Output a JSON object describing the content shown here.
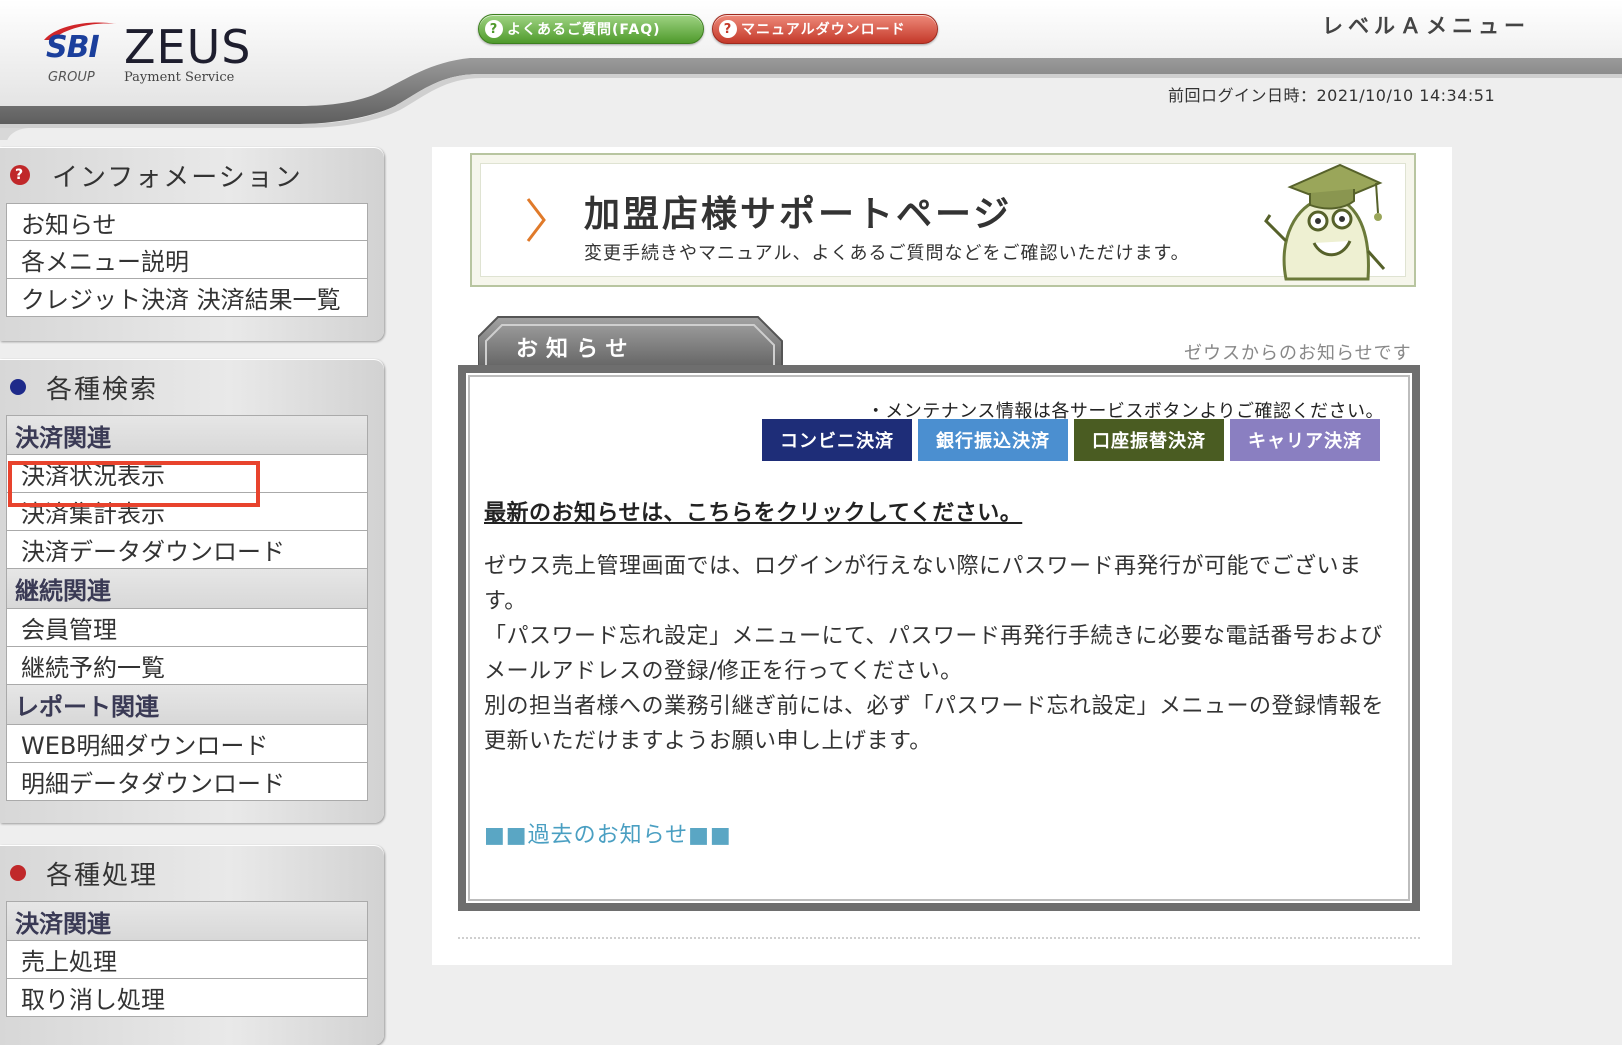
{
  "header": {
    "logo_sbi": "SBI",
    "logo_zeus": "ZEUS",
    "logo_group": "GROUP",
    "logo_service": "Payment Service",
    "faq_button": "よくあるご質問(FAQ)",
    "manual_button": "マニュアルダウンロード",
    "level_title": "レベルＡメニュー",
    "last_login": "前回ログイン日時：2021/10/10 14:34:51"
  },
  "sidebar": {
    "info": {
      "title": "インフォメーション",
      "items": [
        "お知らせ",
        "各メニュー説明",
        "クレジット決済 決済結果一覧"
      ]
    },
    "search": {
      "title": "各種検索",
      "groups": [
        {
          "category": "決済関連",
          "items": [
            "決済状況表示",
            "決済集計表示",
            "決済データダウンロード"
          ]
        },
        {
          "category": "継続関連",
          "items": [
            "会員管理",
            "継続予約一覧"
          ]
        },
        {
          "category": "レポート関連",
          "items": [
            "WEB明細ダウンロード",
            "明細データダウンロード"
          ]
        }
      ]
    },
    "process": {
      "title": "各種処理",
      "groups": [
        {
          "category": "決済関連",
          "items": [
            "売上処理",
            "取り消し処理"
          ]
        }
      ]
    }
  },
  "main": {
    "support_title": "加盟店様サポートページ",
    "support_sub": "変更手続きやマニュアル、よくあるご質問などをご確認いただけます。",
    "notice_tab": "お知らせ",
    "notice_caption": "ゼウスからのお知らせです",
    "maintenance_note": "・メンテナンス情報は各サービスボタンよりご確認ください。",
    "services": [
      "コンビニ決済",
      "銀行振込決済",
      "口座振替決済",
      "キャリア決済"
    ],
    "latest_link": "最新のお知らせは、こちらをクリックしてください。",
    "paragraphs": [
      "ゼウス売上管理画面では、ログインが行えない際にパスワード再発行が可能でございます。",
      "「パスワード忘れ設定」メニューにて、パスワード再発行手続きに必要な電話番号およびメールアドレスの登録/修正を行ってください。",
      "別の担当者様への業務引継ぎ前には、必ず「パスワード忘れ設定」メニューの登録情報を更新いただけますようお願い申し上げます。"
    ],
    "past_link_marker": "■■",
    "past_link": "過去のお知らせ"
  },
  "colors": {
    "highlight": "#e8432d",
    "search_dot": "#1e2a8a",
    "process_dot": "#c0282a",
    "svc_konbini": "#1e2d78",
    "svc_bank": "#4b8fd0",
    "svc_account": "#4a5c22",
    "svc_carrier": "#8a7fc1"
  }
}
